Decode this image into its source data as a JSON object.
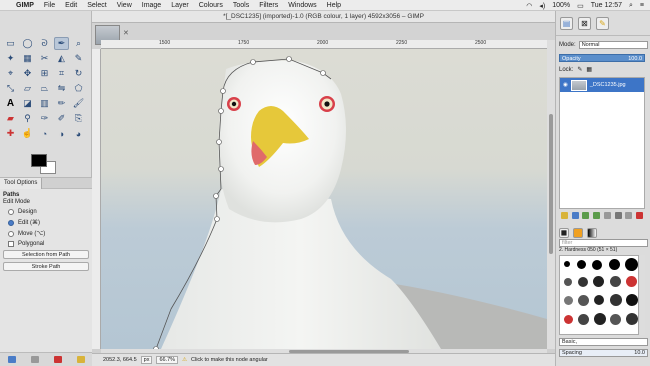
{
  "menubar": {
    "app": "GIMP",
    "menus": [
      "File",
      "Edit",
      "Select",
      "View",
      "Image",
      "Layer",
      "Colours",
      "Tools",
      "Filters",
      "Windows",
      "Help"
    ],
    "battery": "100%",
    "clock": "Tue 12:57"
  },
  "toolbox": {
    "tool_options_tab": "Tool Options",
    "title": "Paths",
    "edit_mode_label": "Edit Mode",
    "modes": [
      "Design",
      "Edit (⌘)",
      "Move (⌥)"
    ],
    "selected_mode": 1,
    "polygonal_label": "Polygonal",
    "selection_button": "Selection from Path",
    "stroke_button": "Stroke Path"
  },
  "image_window": {
    "title": "*[_DSC1235] (imported)-1.0 (RGB colour, 1 layer) 4592x3056 – GIMP",
    "ruler_labels": [
      "1500",
      "1750",
      "2000",
      "2250",
      "2500"
    ],
    "coords": "2052.3, 664.5",
    "unit": "px",
    "zoom": "66.7%",
    "status": "Click to make this node angular"
  },
  "dock": {
    "mode_label": "Mode:",
    "mode_value": "Normal",
    "opacity_label": "Opacity",
    "opacity_value": "100.0",
    "lock_label": "Lock:",
    "layer_name": "_DSC1235.jpg",
    "brush_filter": "filter",
    "brush_name": "2. Hardness 050 (51 × 51)",
    "brush_tag": "Basic,",
    "spacing_label": "Spacing",
    "spacing_value": "10.0"
  },
  "colors": {
    "accent": "#3d75c7",
    "path_node": "#ffffff"
  }
}
